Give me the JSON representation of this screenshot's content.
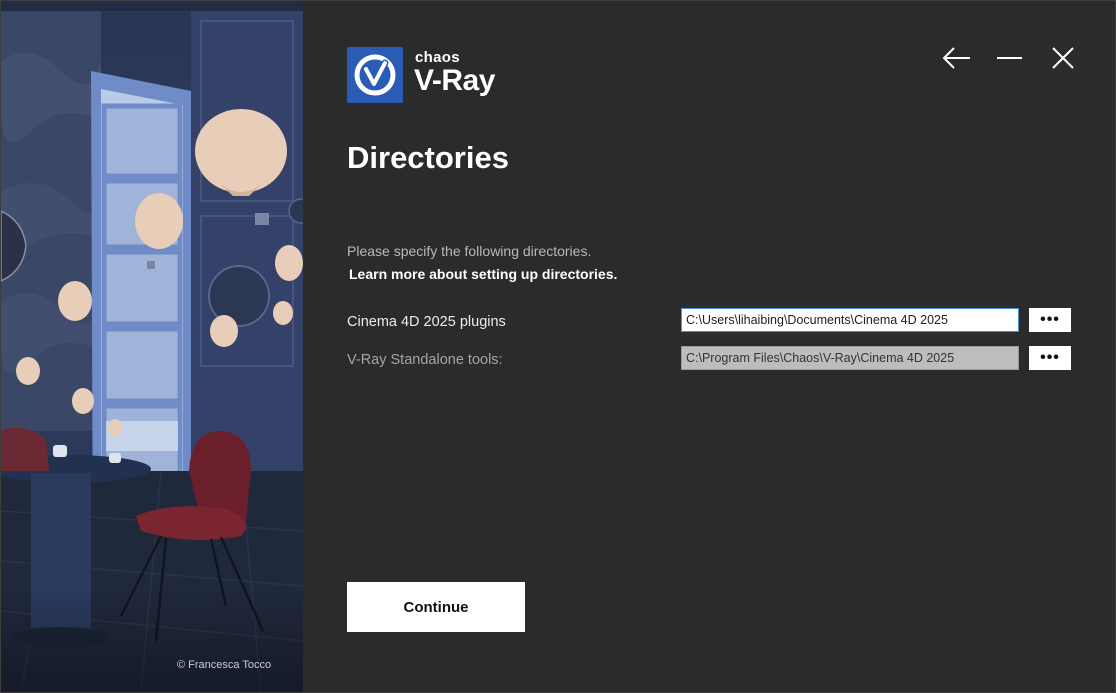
{
  "brand": {
    "company": "chaos",
    "product": "V-Ray",
    "logo_color": "#2a5bb5"
  },
  "artwork": {
    "credit": "© Francesca Tocco"
  },
  "window_controls": {
    "back_icon": "arrow-left-icon",
    "minimize_icon": "minimize-icon",
    "close_icon": "close-icon"
  },
  "page": {
    "title": "Directories",
    "description": "Please specify the following directories.",
    "learn_more_link": "Learn more about setting up directories."
  },
  "directories": [
    {
      "label": "Cinema 4D 2025 plugins",
      "value": "C:\\Users\\lihaibing\\Documents\\Cinema 4D 2025",
      "browse_label": "•••",
      "enabled": true
    },
    {
      "label": "V-Ray Standalone tools:",
      "value": "C:\\Program Files\\Chaos\\V-Ray\\Cinema 4D 2025",
      "browse_label": "•••",
      "enabled": false
    }
  ],
  "actions": {
    "continue_label": "Continue"
  },
  "colors": {
    "panel_background": "#2b2b2b",
    "text_primary": "#ffffff",
    "text_muted": "#b9b9b9",
    "input_focus_border": "#4a90d9"
  }
}
